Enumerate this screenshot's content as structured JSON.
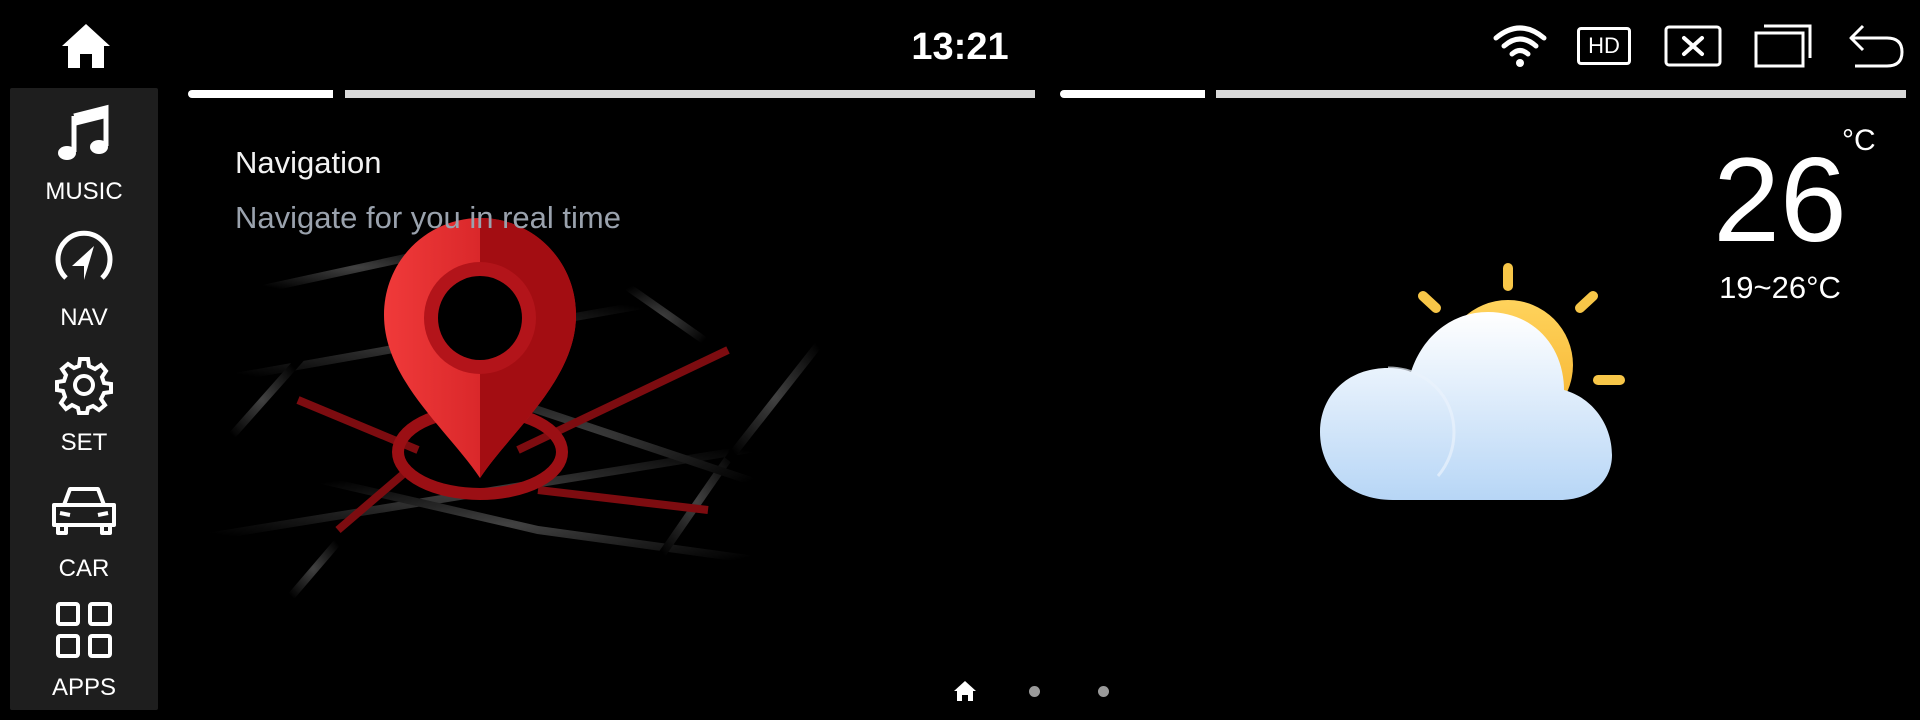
{
  "status_bar": {
    "time": "13:21",
    "hd_label": "HD",
    "icons": [
      "home-icon",
      "wifi-icon",
      "hd-icon",
      "close-window-icon",
      "multi-window-icon",
      "back-icon"
    ]
  },
  "sidebar": {
    "items": [
      {
        "label": "MUSIC",
        "icon": "music-note-icon"
      },
      {
        "label": "NAV",
        "icon": "navigation-icon"
      },
      {
        "label": "SET",
        "icon": "gear-icon"
      },
      {
        "label": "CAR",
        "icon": "car-icon"
      },
      {
        "label": "APPS",
        "icon": "apps-grid-icon"
      }
    ]
  },
  "navigation_card": {
    "title": "Navigation",
    "subtitle": "Navigate for you in real time",
    "accent": "#d01c1f"
  },
  "weather_card": {
    "temperature": "26",
    "unit": "°C",
    "range": "19~26°C",
    "icon": "partly-cloudy-icon"
  },
  "pager": {
    "pages": [
      "home-icon",
      "dot",
      "dot"
    ],
    "active_index": 0
  }
}
